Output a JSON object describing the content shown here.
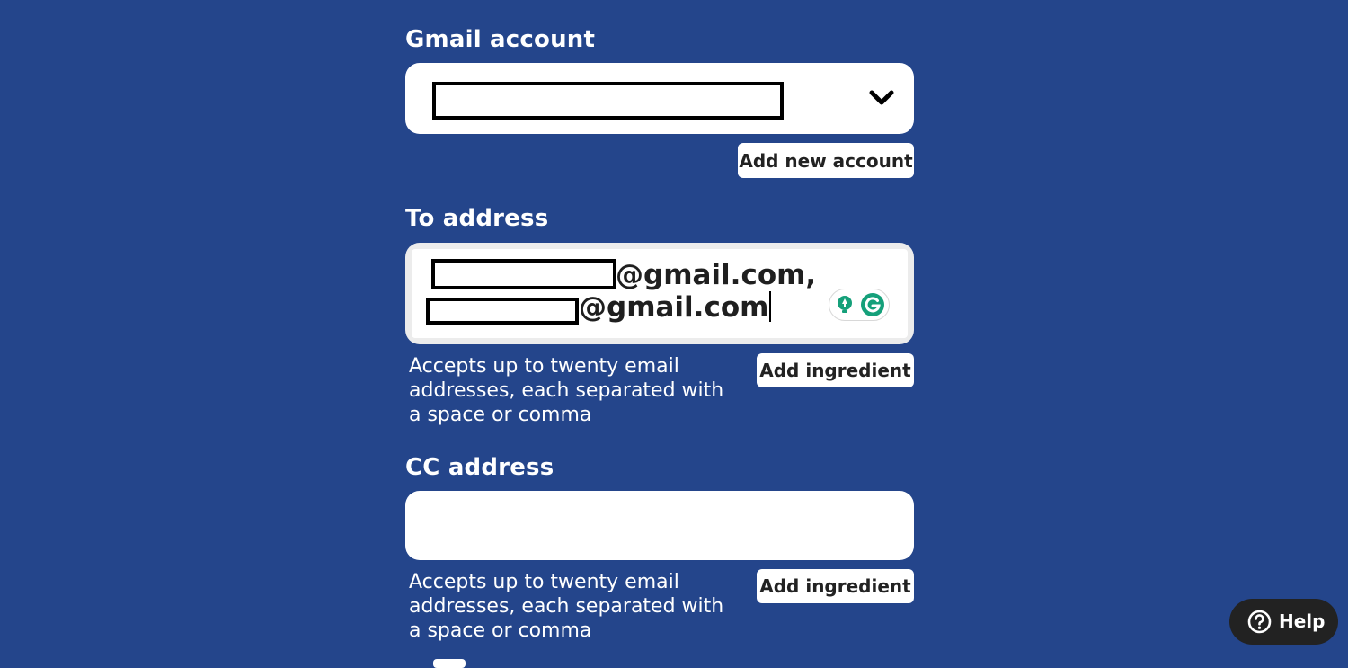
{
  "gmail_account": {
    "label": "Gmail account",
    "add_account_label": "Add new account",
    "chevron_icon": "chevron-down-icon"
  },
  "to_address": {
    "label": "To address",
    "emails": [
      "@gmail.com,",
      "@gmail.com"
    ],
    "helper": "Accepts up to twenty email addresses, each separated with a space or comma",
    "add_ingredient_label": "Add ingredient",
    "grammarly_icons": [
      "bulb-icon",
      "grammarly-icon"
    ]
  },
  "cc_address": {
    "label": "CC address",
    "value": "",
    "helper": "Accepts up to twenty email addresses, each separated with a space or comma",
    "add_ingredient_label": "Add ingredient"
  },
  "help": {
    "label": "Help",
    "icon": "question-circle-icon"
  },
  "colors": {
    "background": "#24458b",
    "help_button": "#222222",
    "grammarly_green": "#15a07a"
  }
}
